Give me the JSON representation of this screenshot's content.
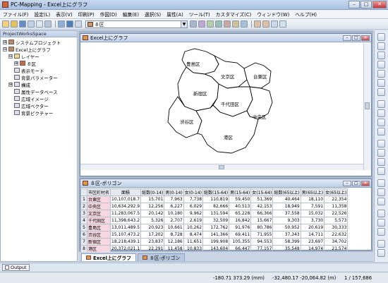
{
  "app": {
    "title": "PC-Mapping - Excel上にグラフ",
    "min": "–",
    "max": "□",
    "close": "✕"
  },
  "menu": [
    "ファイル(F)",
    "設定(L)",
    "表示(V)",
    "印刷(P)",
    "作図(D)",
    "編集(E)",
    "選択(S)",
    "属性(A)",
    "ツール(T)",
    "カスタマイズ(C)",
    "ウィンドウ(W)",
    "ヘルプ(H)"
  ],
  "toolbar": {
    "layer_combo": "８区"
  },
  "left_panel": {
    "header": "ProjectWorksSpace",
    "items": [
      {
        "label": "システムプロジェクト",
        "exp": "⊞"
      },
      {
        "label": "Excel上にグラフ",
        "exp": "⊟"
      },
      {
        "label": "レイヤー",
        "exp": "⊟"
      },
      {
        "label": "８区",
        "exp": "⊞"
      },
      {
        "label": "表示モード",
        "exp": ""
      },
      {
        "label": "背景パラメーター",
        "exp": ""
      },
      {
        "label": "構成",
        "exp": "⊞"
      },
      {
        "label": "属性データベース",
        "exp": ""
      },
      {
        "label": "広域イメージ",
        "exp": ""
      },
      {
        "label": "広域ベクター",
        "exp": ""
      },
      {
        "label": "背景ピクチャー",
        "exp": ""
      }
    ]
  },
  "map_window": {
    "title": "Excel上にグラフ",
    "wards": [
      "豊島区",
      "文京区",
      "台東区",
      "新宿区",
      "千代田区",
      "渋谷区",
      "中央区",
      "港区"
    ]
  },
  "table_window": {
    "title": "８区-ポリゴン",
    "columns": [
      "",
      "市区町村名",
      "面積",
      "総数(0-14)",
      "男(0-14)",
      "女(0-14)",
      "総数(15-64)",
      "男(15-64)",
      "女(15-64)",
      "総数(65以上)",
      "男(65以上)",
      "女(65以上)"
    ],
    "rows": [
      [
        "1",
        "台東区",
        "10,107,018.7",
        "15,701",
        "7,963",
        "7,738",
        "110,819",
        "59,450",
        "51,369",
        "40,464",
        "18,110",
        "22,354"
      ],
      [
        "2",
        "中央区",
        "10,634,292.9",
        "12,256",
        "6,227",
        "6,029",
        "82,666",
        "40,513",
        "42,153",
        "18,949",
        "7,591",
        "11,358"
      ],
      [
        "3",
        "文京区",
        "11,283,067.5",
        "20,142",
        "10,180",
        "9,962",
        "131,594",
        "65,228",
        "66,366",
        "37,558",
        "15,032",
        "22,526"
      ],
      [
        "4",
        "千代田区",
        "11,398,643.2",
        "5,326",
        "2,707",
        "2,619",
        "32,509",
        "16,842",
        "15,667",
        "9,303",
        "3,730",
        "5,573"
      ],
      [
        "5",
        "豊島区",
        "13,011,489.5",
        "20,923",
        "10,661",
        "10,262",
        "172,762",
        "91,976",
        "80,786",
        "50,952",
        "20,619",
        "30,333"
      ],
      [
        "6",
        "渋谷区",
        "15,107,473.2",
        "17,202",
        "8,728",
        "8,474",
        "141,366",
        "69,411",
        "71,955",
        "37,343",
        "14,711",
        "22,632"
      ],
      [
        "7",
        "新宿区",
        "18,218,439.1",
        "23,837",
        "12,186",
        "11,651",
        "199,908",
        "105,355",
        "94,553",
        "58,399",
        "23,697",
        "34,702"
      ],
      [
        "8",
        "港区",
        "20,372,021.1",
        "22,291",
        "11,458",
        "10,833",
        "143,604",
        "66,447",
        "77,157",
        "35,548",
        "14,974",
        "21,574"
      ]
    ]
  },
  "tabs": [
    "Excel上にグラフ",
    "８区-ポリゴン"
  ],
  "output": "Output",
  "status": {
    "coord1": "-180.71 373.29 (mm)",
    "coord2": "-32,480.17 -20,064.82 (m)",
    "scale": "1 / 157,686"
  }
}
